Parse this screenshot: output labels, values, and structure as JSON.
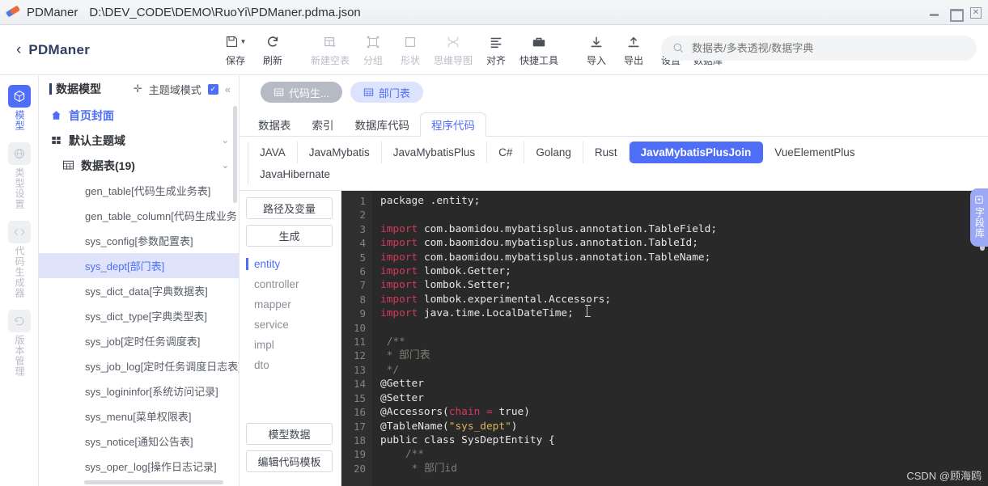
{
  "titlebar": {
    "app_name": "PDManer",
    "file_path": "D:\\DEV_CODE\\DEMO\\RuoYi\\PDManer.pdma.json",
    "minimize": "–",
    "maximize": "□",
    "close": "✕"
  },
  "header": {
    "back_chevron": "‹",
    "brand": "PDManer",
    "tools": [
      {
        "label": "保存",
        "icon": "save-icon",
        "dim": false,
        "caret": true
      },
      {
        "label": "刷新",
        "icon": "refresh-icon",
        "dim": false,
        "caret": false
      },
      {
        "label": "新建空表",
        "icon": "new-table-icon",
        "dim": true,
        "caret": false
      },
      {
        "label": "分组",
        "icon": "group-icon",
        "dim": true,
        "caret": false
      },
      {
        "label": "形状",
        "icon": "shape-icon",
        "dim": true,
        "caret": false
      },
      {
        "label": "思维导图",
        "icon": "mindmap-icon",
        "dim": true,
        "caret": false
      },
      {
        "label": "对齐",
        "icon": "align-icon",
        "dim": false,
        "caret": false
      },
      {
        "label": "快捷工具",
        "icon": "toolbox-icon",
        "dim": false,
        "caret": false
      },
      {
        "label": "导入",
        "icon": "import-icon",
        "dim": false,
        "caret": false
      },
      {
        "label": "导出",
        "icon": "export-icon",
        "dim": false,
        "caret": false
      },
      {
        "label": "设置",
        "icon": "gear-icon",
        "dim": false,
        "caret": false
      },
      {
        "label": "数据库",
        "icon": "database-icon",
        "dim": false,
        "caret": false
      }
    ],
    "search_placeholder": "数据表/多表透视/数据字典"
  },
  "rail": [
    {
      "label": "模型",
      "icon": "cube-icon",
      "active": true
    },
    {
      "label": "类型设置",
      "icon": "globe-icon",
      "active": false
    },
    {
      "label": "代码生成器",
      "icon": "code-icon",
      "active": false
    },
    {
      "label": "版本管理",
      "icon": "history-icon",
      "active": false
    }
  ],
  "tree": {
    "title": "数据模型",
    "mode_label": "主题域模式",
    "mode_checked": "✓",
    "collapse_icon": "«",
    "add_icon": "✛",
    "items": [
      {
        "label": "首页封面",
        "level": 0,
        "style": "home",
        "icon": "home-icon",
        "arrow": ""
      },
      {
        "label": "默认主题域",
        "level": 1,
        "style": "strong",
        "icon": "grid-icon",
        "arrow": "⌄"
      },
      {
        "label": "数据表(19)",
        "level": 2,
        "style": "strong",
        "icon": "table-icon",
        "arrow": "⌄"
      },
      {
        "label": "gen_table[代码生成业务表]",
        "level": 3,
        "style": "leaf",
        "icon": "",
        "arrow": ""
      },
      {
        "label": "gen_table_column[代码生成业务",
        "level": 3,
        "style": "leaf",
        "icon": "",
        "arrow": ""
      },
      {
        "label": "sys_config[参数配置表]",
        "level": 3,
        "style": "leaf",
        "icon": "",
        "arrow": ""
      },
      {
        "label": "sys_dept[部门表]",
        "level": 3,
        "style": "leaf selected",
        "icon": "",
        "arrow": ""
      },
      {
        "label": "sys_dict_data[字典数据表]",
        "level": 3,
        "style": "leaf",
        "icon": "",
        "arrow": ""
      },
      {
        "label": "sys_dict_type[字典类型表]",
        "level": 3,
        "style": "leaf",
        "icon": "",
        "arrow": ""
      },
      {
        "label": "sys_job[定时任务调度表]",
        "level": 3,
        "style": "leaf",
        "icon": "",
        "arrow": ""
      },
      {
        "label": "sys_job_log[定时任务调度日志表]",
        "level": 3,
        "style": "leaf",
        "icon": "",
        "arrow": ""
      },
      {
        "label": "sys_logininfor[系统访问记录]",
        "level": 3,
        "style": "leaf",
        "icon": "",
        "arrow": ""
      },
      {
        "label": "sys_menu[菜单权限表]",
        "level": 3,
        "style": "leaf",
        "icon": "",
        "arrow": ""
      },
      {
        "label": "sys_notice[通知公告表]",
        "level": 3,
        "style": "leaf",
        "icon": "",
        "arrow": ""
      },
      {
        "label": "sys_oper_log[操作日志记录]",
        "level": 3,
        "style": "leaf",
        "icon": "",
        "arrow": ""
      }
    ]
  },
  "main": {
    "chips": [
      {
        "label": "代码生...",
        "state": "inactive"
      },
      {
        "label": "部门表",
        "state": "active"
      }
    ],
    "subtabs": [
      {
        "label": "数据表",
        "active": false
      },
      {
        "label": "索引",
        "active": false
      },
      {
        "label": "数据库代码",
        "active": false
      },
      {
        "label": "程序代码",
        "active": true
      }
    ],
    "languages": [
      {
        "label": "JAVA",
        "active": false
      },
      {
        "label": "JavaMybatis",
        "active": false
      },
      {
        "label": "JavaMybatisPlus",
        "active": false
      },
      {
        "label": "C#",
        "active": false
      },
      {
        "label": "Golang",
        "active": false
      },
      {
        "label": "Rust",
        "active": false
      },
      {
        "label": "JavaMybatisPlusJoin",
        "active": true
      },
      {
        "label": "VueElementPlus",
        "active": false
      },
      {
        "label": "JavaHibernate",
        "active": false
      }
    ],
    "leftpane": {
      "top_buttons": [
        {
          "label": "路径及变量"
        },
        {
          "label": "生成"
        }
      ],
      "packages": [
        {
          "label": "entity",
          "active": true
        },
        {
          "label": "controller",
          "active": false
        },
        {
          "label": "mapper",
          "active": false
        },
        {
          "label": "service",
          "active": false
        },
        {
          "label": "impl",
          "active": false
        },
        {
          "label": "dto",
          "active": false
        }
      ],
      "bottom_buttons": [
        {
          "label": "模型数据"
        },
        {
          "label": "编辑代码模板"
        }
      ]
    },
    "right_tab": {
      "label": "字段库",
      "icon": "library-icon"
    }
  },
  "editor": {
    "first_line": 1,
    "last_line": 20,
    "lines": [
      {
        "n": 1,
        "html": "<span class=\"kw2\">package</span> .entity;"
      },
      {
        "n": 2,
        "html": ""
      },
      {
        "n": 3,
        "html": "<span class=\"kw\">import</span> com.baomidou.mybatisplus.annotation.TableField;"
      },
      {
        "n": 4,
        "html": "<span class=\"kw\">import</span> com.baomidou.mybatisplus.annotation.TableId;"
      },
      {
        "n": 5,
        "html": "<span class=\"kw\">import</span> com.baomidou.mybatisplus.annotation.TableName;"
      },
      {
        "n": 6,
        "html": "<span class=\"kw\">import</span> lombok.Getter;"
      },
      {
        "n": 7,
        "html": "<span class=\"kw\">import</span> lombok.Setter;"
      },
      {
        "n": 8,
        "html": "<span class=\"kw\">import</span> lombok.experimental.Accessors;"
      },
      {
        "n": 9,
        "html": "<span class=\"kw\">import</span> java.time.LocalDateTime;"
      },
      {
        "n": 10,
        "html": ""
      },
      {
        "n": 11,
        "html": " <span class=\"cm\">/**</span>"
      },
      {
        "n": 12,
        "html": " <span class=\"cm\">* 部门表</span>"
      },
      {
        "n": 13,
        "html": " <span class=\"cm\">*/</span>"
      },
      {
        "n": 14,
        "html": "<span class=\"ann\">@Getter</span>"
      },
      {
        "n": 15,
        "html": "<span class=\"ann\">@Setter</span>"
      },
      {
        "n": 16,
        "html": "<span class=\"ann\">@Accessors(</span><span class=\"kw\">chain</span> <span class=\"kw\">=</span> true)"
      },
      {
        "n": 17,
        "html": "<span class=\"ann\">@TableName(</span><span class=\"str\">\"sys_dept\"</span>)"
      },
      {
        "n": 18,
        "html": "public class SysDeptEntity {"
      },
      {
        "n": 19,
        "html": "    <span class=\"cm\">/**</span>"
      },
      {
        "n": 20,
        "html": "     <span class=\"cm\">* 部门id</span>"
      }
    ],
    "plain_text": [
      "package .entity;",
      "",
      "import com.baomidou.mybatisplus.annotation.TableField;",
      "import com.baomidou.mybatisplus.annotation.TableId;",
      "import com.baomidou.mybatisplus.annotation.TableName;",
      "import lombok.Getter;",
      "import lombok.Setter;",
      "import lombok.experimental.Accessors;",
      "import java.time.LocalDateTime;",
      "",
      " /**",
      "  * 部门表",
      "  */",
      "@Getter",
      "@Setter",
      "@Accessors(chain = true)",
      "@TableName(\"sys_dept\")",
      "public class SysDeptEntity {",
      "     /**",
      "      * 部门id"
    ]
  },
  "watermark": "CSDN @顾海鸥",
  "colors": {
    "accent": "#4f6ef7",
    "chip_active_bg": "#dde3fd",
    "chip_inactive_bg": "#b6bac4",
    "tree_selected_bg": "#dfe4fb",
    "editor_bg": "#292929",
    "gutter_bg": "#2f2f2f",
    "keyword": "#d3395e",
    "string": "#d9b65a",
    "comment": "#7d7f72",
    "right_tab_bg": "#9aa8f6"
  }
}
